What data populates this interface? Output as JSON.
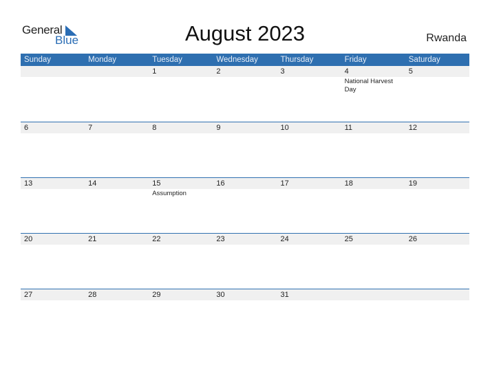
{
  "logo": {
    "general": "General",
    "blue": "Blue",
    "accent_color": "#2a6db5"
  },
  "title": "August 2023",
  "country": "Rwanda",
  "weekdays": [
    "Sunday",
    "Monday",
    "Tuesday",
    "Wednesday",
    "Thursday",
    "Friday",
    "Saturday"
  ],
  "weeks": [
    {
      "days": [
        "",
        "",
        "1",
        "2",
        "3",
        "4",
        "5"
      ],
      "events": [
        "",
        "",
        "",
        "",
        "",
        "National Harvest Day",
        ""
      ]
    },
    {
      "days": [
        "6",
        "7",
        "8",
        "9",
        "10",
        "11",
        "12"
      ],
      "events": [
        "",
        "",
        "",
        "",
        "",
        "",
        ""
      ]
    },
    {
      "days": [
        "13",
        "14",
        "15",
        "16",
        "17",
        "18",
        "19"
      ],
      "events": [
        "",
        "",
        "Assumption",
        "",
        "",
        "",
        ""
      ]
    },
    {
      "days": [
        "20",
        "21",
        "22",
        "23",
        "24",
        "25",
        "26"
      ],
      "events": [
        "",
        "",
        "",
        "",
        "",
        "",
        ""
      ]
    },
    {
      "days": [
        "27",
        "28",
        "29",
        "30",
        "31",
        "",
        ""
      ],
      "events": [
        "",
        "",
        "",
        "",
        "",
        "",
        ""
      ]
    }
  ],
  "colors": {
    "header_bg": "#2e6fb0",
    "band_bg": "#f0f0f0"
  }
}
